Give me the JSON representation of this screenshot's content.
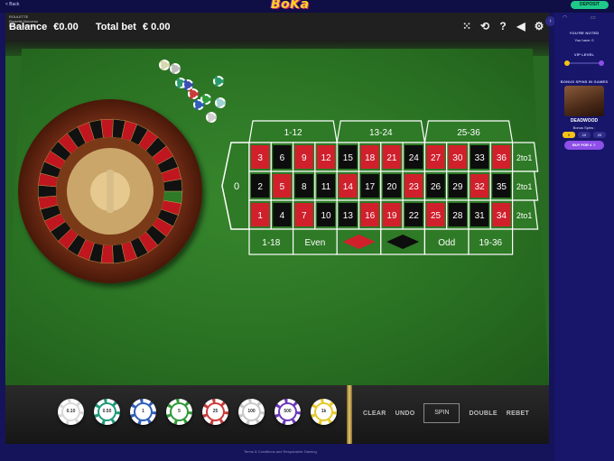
{
  "site": {
    "back_label": "< Back",
    "logo_text": "BoKa",
    "deposit_label": "DEPOSIT"
  },
  "game": {
    "title_line1": "ROULETTE",
    "title_line2": "Roulette Nouveau",
    "title_line3": "RELAX GAMING",
    "balance_label": "Balance",
    "balance_value": "€0.00",
    "total_bet_label": "Total bet",
    "total_bet_value": "€ 0.00",
    "icons": [
      "grid-icon",
      "history-icon",
      "help-icon",
      "sound-icon",
      "settings-icon"
    ]
  },
  "layout": {
    "dozens": [
      "1-12",
      "13-24",
      "25-36"
    ],
    "zero": "0",
    "rows": [
      [
        {
          "n": "3",
          "c": "red"
        },
        {
          "n": "6",
          "c": "black"
        },
        {
          "n": "9",
          "c": "red"
        },
        {
          "n": "12",
          "c": "red"
        },
        {
          "n": "15",
          "c": "black"
        },
        {
          "n": "18",
          "c": "red"
        },
        {
          "n": "21",
          "c": "red"
        },
        {
          "n": "24",
          "c": "black"
        },
        {
          "n": "27",
          "c": "red"
        },
        {
          "n": "30",
          "c": "red"
        },
        {
          "n": "33",
          "c": "black"
        },
        {
          "n": "36",
          "c": "red"
        }
      ],
      [
        {
          "n": "2",
          "c": "black"
        },
        {
          "n": "5",
          "c": "red"
        },
        {
          "n": "8",
          "c": "black"
        },
        {
          "n": "11",
          "c": "black"
        },
        {
          "n": "14",
          "c": "red"
        },
        {
          "n": "17",
          "c": "black"
        },
        {
          "n": "20",
          "c": "black"
        },
        {
          "n": "23",
          "c": "red"
        },
        {
          "n": "26",
          "c": "black"
        },
        {
          "n": "29",
          "c": "black"
        },
        {
          "n": "32",
          "c": "red"
        },
        {
          "n": "35",
          "c": "black"
        }
      ],
      [
        {
          "n": "1",
          "c": "red"
        },
        {
          "n": "4",
          "c": "black"
        },
        {
          "n": "7",
          "c": "red"
        },
        {
          "n": "10",
          "c": "black"
        },
        {
          "n": "13",
          "c": "black"
        },
        {
          "n": "16",
          "c": "red"
        },
        {
          "n": "19",
          "c": "red"
        },
        {
          "n": "22",
          "c": "black"
        },
        {
          "n": "25",
          "c": "red"
        },
        {
          "n": "28",
          "c": "black"
        },
        {
          "n": "31",
          "c": "black"
        },
        {
          "n": "34",
          "c": "red"
        }
      ]
    ],
    "columns": [
      "2to1",
      "2to1",
      "2to1"
    ],
    "outside": [
      "1-18",
      "Even",
      "red-diamond",
      "black-diamond",
      "Odd",
      "19-36"
    ],
    "colors": {
      "red": "#d0202c",
      "black": "#0d0d0d",
      "green": "#2e7a26"
    }
  },
  "chips": [
    "0.10",
    "0.50",
    "1",
    "5",
    "25",
    "100",
    "500",
    "1k"
  ],
  "chip_colors": [
    "#d9d9d9",
    "#1e9a77",
    "#2f5fb7",
    "#2f9a3a",
    "#c93b3b",
    "#c8c8c8",
    "#6b38b8",
    "#e6c82c"
  ],
  "controls": {
    "clear": "CLEAR",
    "undo": "UNDO",
    "spin": "SPIN",
    "double": "DOUBLE",
    "rebet": "REBET"
  },
  "footer_text": "Terms & Conditions and Responsible Gaming",
  "sidebar": {
    "you_noted": "YOU'RE NOTED",
    "you_have": "You have: 0",
    "vip_level": "VIP LEVEL",
    "bonus_spins": "BONUS SPINS IN GAMES",
    "game_title": "DEADWOOD",
    "bonus_spins_label": "Bonus Spins :",
    "pills": [
      "5",
      "10",
      "20"
    ],
    "buy_label": "BUY FOR 4 ♢"
  }
}
